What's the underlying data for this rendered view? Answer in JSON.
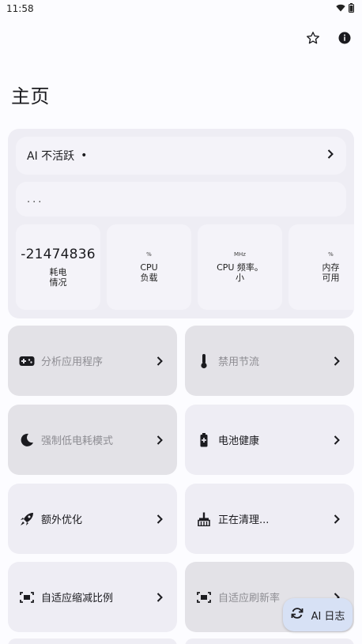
{
  "status_bar": {
    "time": "11:58"
  },
  "header": {
    "title": "主页"
  },
  "overview": {
    "ai_status": "AI 不活跃",
    "ai_dot": "•",
    "placeholder_text": "...",
    "stats": [
      {
        "value": "-21474836",
        "unit": "",
        "label_line1": "耗电",
        "label_line2": "情况"
      },
      {
        "value": "",
        "unit": "%",
        "label_line1": "CPU",
        "label_line2": "负载"
      },
      {
        "value": "",
        "unit": "MHz",
        "label_line1": "CPU 频率。",
        "label_line2": "小"
      },
      {
        "value": "",
        "unit": "%",
        "label_line1": "内存",
        "label_line2": "可用"
      }
    ]
  },
  "features": [
    {
      "label": "分析应用程序",
      "icon": "gamepad-icon",
      "enabled": false
    },
    {
      "label": "禁用节流",
      "icon": "thermometer-icon",
      "enabled": false
    },
    {
      "label": "强制低电耗模式",
      "icon": "moon-icon",
      "enabled": false
    },
    {
      "label": "电池健康",
      "icon": "battery-plus-icon",
      "enabled": true
    },
    {
      "label": "额外优化",
      "icon": "rocket-icon",
      "enabled": true
    },
    {
      "label": "正在清理...",
      "icon": "broom-icon",
      "enabled": true
    },
    {
      "label": "自适应缩减比例",
      "icon": "screen-scale-icon",
      "enabled": true
    },
    {
      "label": "自适应刷新率",
      "icon": "screen-refresh-icon",
      "enabled": false
    }
  ],
  "fab": {
    "label": "AI 日志"
  },
  "colors": {
    "background": "#fcfcff",
    "card": "#eeedf4",
    "disabled_card": "#e3e2e7",
    "fab": "#d7e1f5"
  }
}
